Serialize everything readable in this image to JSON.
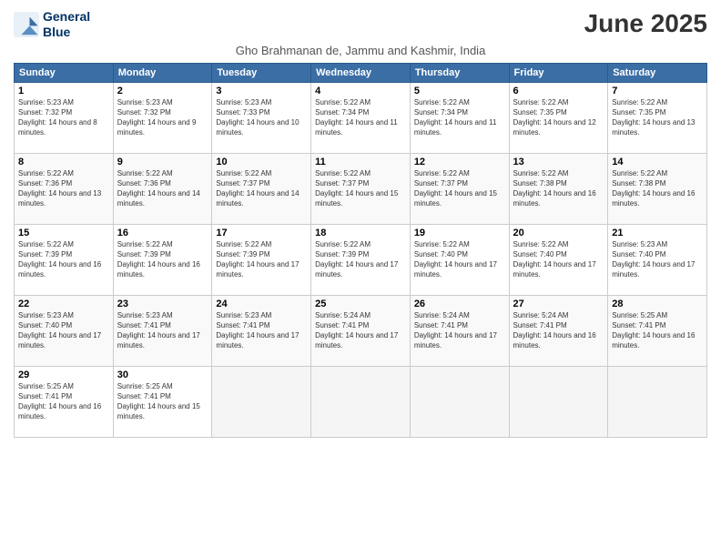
{
  "header": {
    "title": "June 2025",
    "subtitle": "Gho Brahmanan de, Jammu and Kashmir, India",
    "logo_line1": "General",
    "logo_line2": "Blue"
  },
  "days_of_week": [
    "Sunday",
    "Monday",
    "Tuesday",
    "Wednesday",
    "Thursday",
    "Friday",
    "Saturday"
  ],
  "weeks": [
    [
      {
        "day": "1",
        "sunrise": "5:23 AM",
        "sunset": "7:32 PM",
        "daylight": "14 hours and 8 minutes."
      },
      {
        "day": "2",
        "sunrise": "5:23 AM",
        "sunset": "7:32 PM",
        "daylight": "14 hours and 9 minutes."
      },
      {
        "day": "3",
        "sunrise": "5:23 AM",
        "sunset": "7:33 PM",
        "daylight": "14 hours and 10 minutes."
      },
      {
        "day": "4",
        "sunrise": "5:22 AM",
        "sunset": "7:34 PM",
        "daylight": "14 hours and 11 minutes."
      },
      {
        "day": "5",
        "sunrise": "5:22 AM",
        "sunset": "7:34 PM",
        "daylight": "14 hours and 11 minutes."
      },
      {
        "day": "6",
        "sunrise": "5:22 AM",
        "sunset": "7:35 PM",
        "daylight": "14 hours and 12 minutes."
      },
      {
        "day": "7",
        "sunrise": "5:22 AM",
        "sunset": "7:35 PM",
        "daylight": "14 hours and 13 minutes."
      }
    ],
    [
      {
        "day": "8",
        "sunrise": "5:22 AM",
        "sunset": "7:36 PM",
        "daylight": "14 hours and 13 minutes."
      },
      {
        "day": "9",
        "sunrise": "5:22 AM",
        "sunset": "7:36 PM",
        "daylight": "14 hours and 14 minutes."
      },
      {
        "day": "10",
        "sunrise": "5:22 AM",
        "sunset": "7:37 PM",
        "daylight": "14 hours and 14 minutes."
      },
      {
        "day": "11",
        "sunrise": "5:22 AM",
        "sunset": "7:37 PM",
        "daylight": "14 hours and 15 minutes."
      },
      {
        "day": "12",
        "sunrise": "5:22 AM",
        "sunset": "7:37 PM",
        "daylight": "14 hours and 15 minutes."
      },
      {
        "day": "13",
        "sunrise": "5:22 AM",
        "sunset": "7:38 PM",
        "daylight": "14 hours and 16 minutes."
      },
      {
        "day": "14",
        "sunrise": "5:22 AM",
        "sunset": "7:38 PM",
        "daylight": "14 hours and 16 minutes."
      }
    ],
    [
      {
        "day": "15",
        "sunrise": "5:22 AM",
        "sunset": "7:39 PM",
        "daylight": "14 hours and 16 minutes."
      },
      {
        "day": "16",
        "sunrise": "5:22 AM",
        "sunset": "7:39 PM",
        "daylight": "14 hours and 16 minutes."
      },
      {
        "day": "17",
        "sunrise": "5:22 AM",
        "sunset": "7:39 PM",
        "daylight": "14 hours and 17 minutes."
      },
      {
        "day": "18",
        "sunrise": "5:22 AM",
        "sunset": "7:39 PM",
        "daylight": "14 hours and 17 minutes."
      },
      {
        "day": "19",
        "sunrise": "5:22 AM",
        "sunset": "7:40 PM",
        "daylight": "14 hours and 17 minutes."
      },
      {
        "day": "20",
        "sunrise": "5:22 AM",
        "sunset": "7:40 PM",
        "daylight": "14 hours and 17 minutes."
      },
      {
        "day": "21",
        "sunrise": "5:23 AM",
        "sunset": "7:40 PM",
        "daylight": "14 hours and 17 minutes."
      }
    ],
    [
      {
        "day": "22",
        "sunrise": "5:23 AM",
        "sunset": "7:40 PM",
        "daylight": "14 hours and 17 minutes."
      },
      {
        "day": "23",
        "sunrise": "5:23 AM",
        "sunset": "7:41 PM",
        "daylight": "14 hours and 17 minutes."
      },
      {
        "day": "24",
        "sunrise": "5:23 AM",
        "sunset": "7:41 PM",
        "daylight": "14 hours and 17 minutes."
      },
      {
        "day": "25",
        "sunrise": "5:24 AM",
        "sunset": "7:41 PM",
        "daylight": "14 hours and 17 minutes."
      },
      {
        "day": "26",
        "sunrise": "5:24 AM",
        "sunset": "7:41 PM",
        "daylight": "14 hours and 17 minutes."
      },
      {
        "day": "27",
        "sunrise": "5:24 AM",
        "sunset": "7:41 PM",
        "daylight": "14 hours and 16 minutes."
      },
      {
        "day": "28",
        "sunrise": "5:25 AM",
        "sunset": "7:41 PM",
        "daylight": "14 hours and 16 minutes."
      }
    ],
    [
      {
        "day": "29",
        "sunrise": "5:25 AM",
        "sunset": "7:41 PM",
        "daylight": "14 hours and 16 minutes."
      },
      {
        "day": "30",
        "sunrise": "5:25 AM",
        "sunset": "7:41 PM",
        "daylight": "14 hours and 15 minutes."
      },
      null,
      null,
      null,
      null,
      null
    ]
  ]
}
